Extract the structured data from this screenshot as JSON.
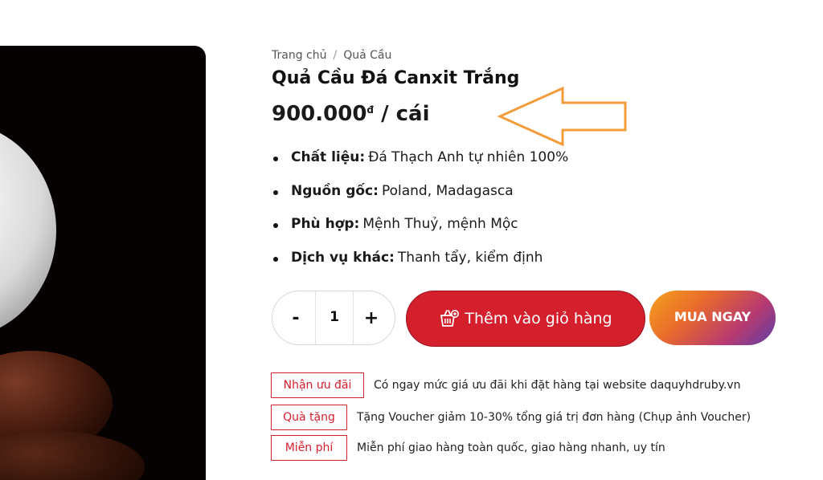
{
  "breadcrumb": {
    "home": "Trang chủ",
    "separator": "/",
    "current": "Quả Cầu"
  },
  "product": {
    "title": "Quả Cầu Đá Canxit Trắng",
    "price": "900.000",
    "currency": "đ",
    "unit": "/ cái"
  },
  "specs": [
    {
      "label": "Chất liệu:",
      "value": "Đá Thạch Anh tự nhiên 100%"
    },
    {
      "label": "Nguồn gốc:",
      "value": "Poland, Madagasca"
    },
    {
      "label": "Phù hợp:",
      "value": "Mệnh Thuỷ, mệnh Mộc"
    },
    {
      "label": "Dịch vụ khác:",
      "value": "Thanh tẩy, kiểm định"
    }
  ],
  "quantity": {
    "minus": "-",
    "value": "1",
    "plus": "+"
  },
  "buttons": {
    "add_to_cart": "Thêm vào giỏ hàng",
    "buy_now": "MUA NGAY"
  },
  "offers": [
    {
      "tag": "Nhận ưu đãi",
      "text": "Có ngay mức giá ưu đãi khi đặt hàng tại website daquyhdruby.vn"
    },
    {
      "tag": "Quà tặng",
      "text": "Tặng Voucher giảm 10-30% tổng giá trị đơn hàng (Chụp ảnh Voucher)"
    },
    {
      "tag": "Miễn phí",
      "text": "Miễn phí giao hàng toàn quốc, giao hàng nhanh, uy tín"
    }
  ],
  "icons": {
    "cart": "shopping-basket-icon",
    "annotation": "arrow-left-icon"
  },
  "colors": {
    "accent_red": "#d41f2d",
    "annotation_orange": "#f39c3a",
    "buy_gradient_start": "#f6a11b",
    "buy_gradient_end": "#5d3fa6"
  }
}
